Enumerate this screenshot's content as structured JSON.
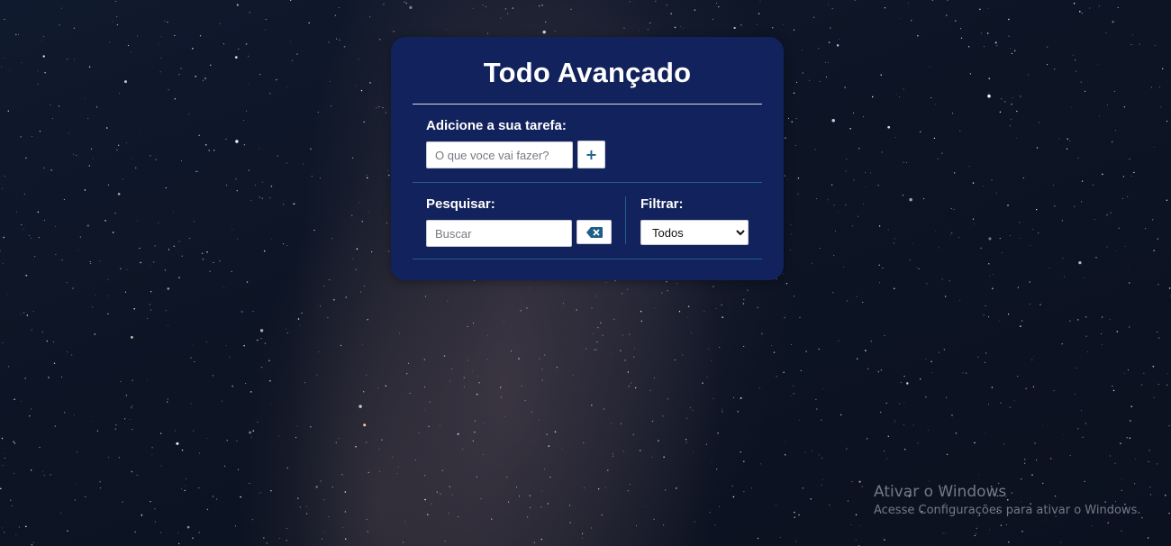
{
  "app": {
    "title": "Todo Avançado"
  },
  "add": {
    "label": "Adicione a sua tarefa:",
    "input_placeholder": "O que voce vai fazer?",
    "input_value": "",
    "button_label": "+"
  },
  "search": {
    "label": "Pesquisar:",
    "input_placeholder": "Buscar",
    "input_value": "",
    "clear_icon": "backspace-icon"
  },
  "filter": {
    "label": "Filtrar:",
    "selected": "Todos"
  },
  "watermark": {
    "title": "Ativar o Windows",
    "subtitle": "Acesse Configurações para ativar o Windows."
  },
  "colors": {
    "card_bg": "#12225c",
    "accent": "#1e5f8a",
    "divider": "#1f5f8c"
  }
}
